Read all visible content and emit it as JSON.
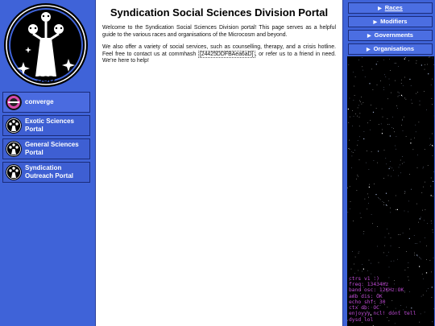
{
  "logo": {
    "text": "SSD"
  },
  "sidebar": {
    "items": [
      {
        "label": "converge",
        "icon": "converge-logo-icon"
      },
      {
        "label": "Exotic Sciences Portal",
        "icon": "ssd-badge-icon"
      },
      {
        "label": "General Sciences Portal",
        "icon": "ssd-badge-icon"
      },
      {
        "label": "Syndication Outreach Portal",
        "icon": "ssd-badge-icon"
      }
    ]
  },
  "main": {
    "title": "Syndication Social Sciences Division Portal",
    "p1": "Welcome to the Syndication Social Sciences Division portal! This page serves as a helpful guide to the various races and organisations of the Microcosm and beyond.",
    "p2_before": "We also offer a variety of social services, such as counselling, therapy, and a crisis hotline. Feel free to contact us at commhash ",
    "p2_hash": "[24425DDFBAea6aD]",
    "p2_after": ", or refer us to a friend in need. We're here to help!"
  },
  "right_nav": {
    "items": [
      {
        "label": "Races",
        "active": true
      },
      {
        "label": "Modifiers"
      },
      {
        "label": "Governments"
      },
      {
        "label": "Organisations"
      }
    ]
  },
  "terminal": {
    "lines": [
      "ctrs v1 :)",
      "freq: 13434Hz",
      "band osc: 12KHz:OK",
      "amb dis: OK",
      "echo shf: 30",
      "ctx db: OC",
      "enjoyyy ncl! dont tell",
      "dysd lol"
    ]
  },
  "colors": {
    "sidebar": "#3f63d8",
    "panel": "#3e5fd3",
    "terminal_text": "#c04bd6",
    "border": "#1b2c7a"
  }
}
